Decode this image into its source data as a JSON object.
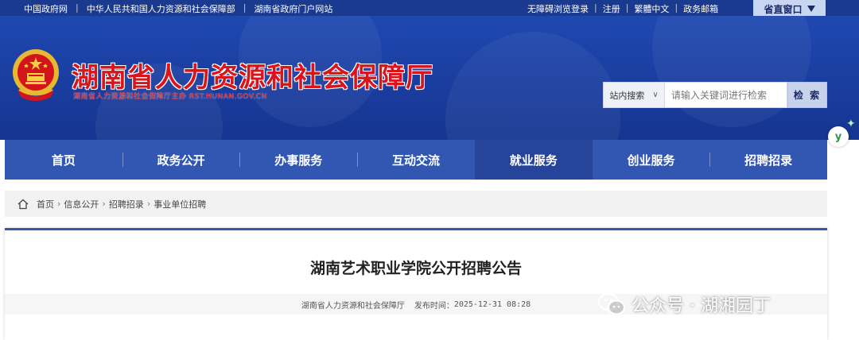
{
  "topbar": {
    "links": [
      "中国政府网",
      "中华人民共和国人力资源和社会保障部",
      "湖南省政府门户网站"
    ],
    "right_links": [
      "无障碍浏览登录",
      "注册",
      "繁體中文",
      "政务邮箱"
    ],
    "region_label": "省直窗口"
  },
  "header": {
    "site_title": "湖南省人力资源和社会保障厅",
    "site_subtitle": "湖南省人力资源和社会保障厅主办  RST.HUNAN.GOV.CN"
  },
  "search": {
    "scope": "站内搜索",
    "placeholder": "请输入关键词进行检索",
    "button": "检 索"
  },
  "float_badge": "y",
  "nav": {
    "items": [
      {
        "label": "首页"
      },
      {
        "label": "政务公开"
      },
      {
        "label": "办事服务"
      },
      {
        "label": "互动交流"
      },
      {
        "label": "就业服务",
        "active": true
      },
      {
        "label": "创业服务"
      },
      {
        "label": "招聘招录"
      }
    ]
  },
  "breadcrumb": [
    "首页",
    "信息公开",
    "招聘招录",
    "事业单位招聘"
  ],
  "article": {
    "title": "湖南艺术职业学院公开招聘公告",
    "source": "湖南省人力资源和社会保障厅",
    "publish_label": "发布时间：",
    "publish_time": "2025-12-31 08:28"
  },
  "watermark": "公众号 · 湖湘园丁",
  "colors": {
    "topbar": "#1a3a8f",
    "banner": "#1e48b0",
    "nav": "#3257b3",
    "nav_active": "#26449a",
    "title_red": "#d9141b"
  }
}
